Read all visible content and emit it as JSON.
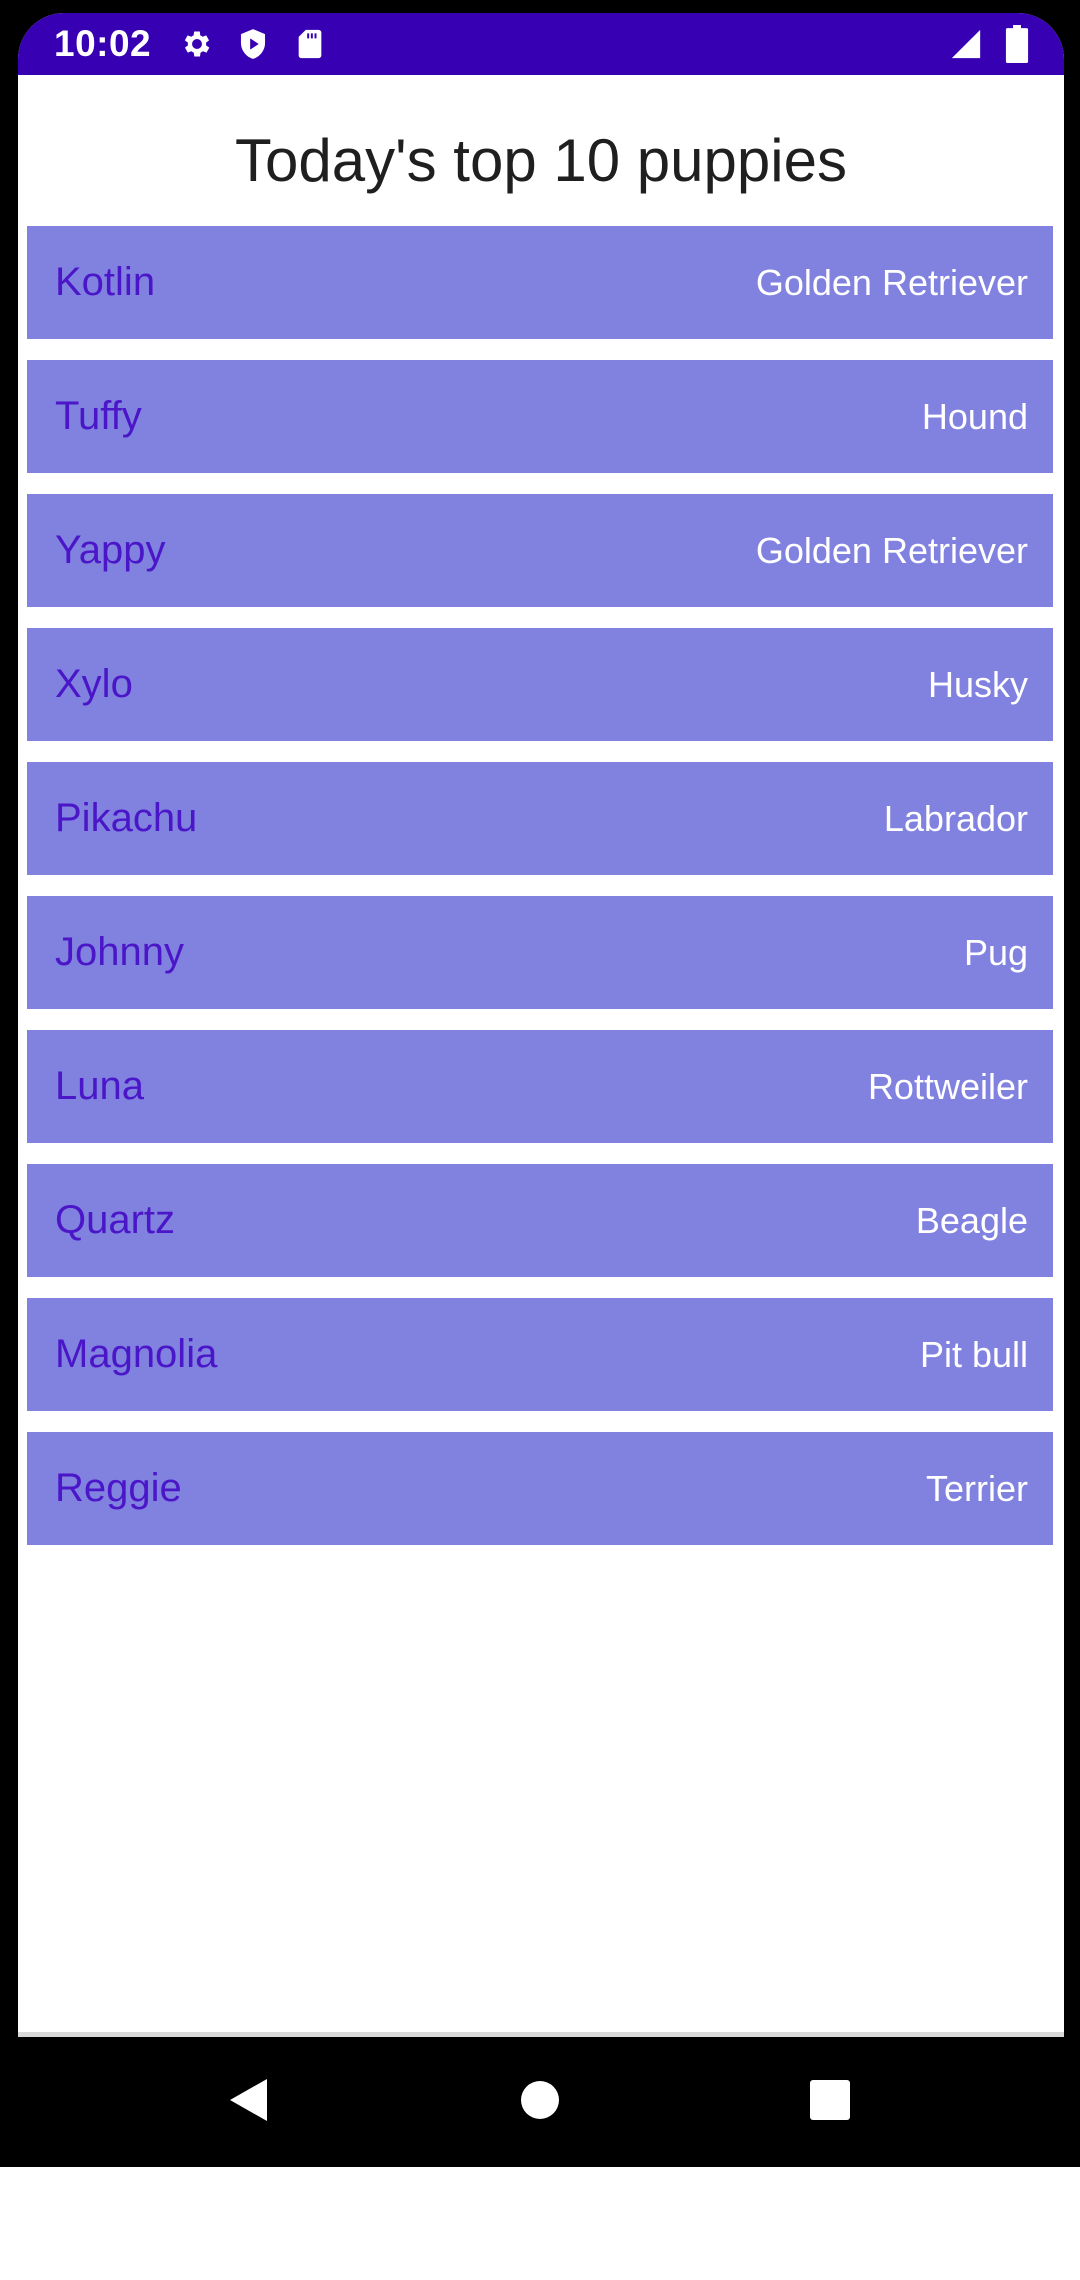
{
  "status_bar": {
    "time": "10:02",
    "background_color": "#3700b3",
    "icons": [
      "gear-icon",
      "shield-icon",
      "sd-card-icon",
      "signal-icon",
      "battery-icon"
    ]
  },
  "page": {
    "title": "Today's top 10 puppies"
  },
  "colors": {
    "row_background": "#8181df",
    "name_text": "#4a16c8",
    "breed_text": "#ffffff"
  },
  "puppies": [
    {
      "name": "Kotlin",
      "breed": "Golden Retriever"
    },
    {
      "name": "Tuffy",
      "breed": "Hound"
    },
    {
      "name": "Yappy",
      "breed": "Golden Retriever"
    },
    {
      "name": "Xylo",
      "breed": "Husky"
    },
    {
      "name": "Pikachu",
      "breed": "Labrador"
    },
    {
      "name": "Johnny",
      "breed": "Pug"
    },
    {
      "name": "Luna",
      "breed": "Rottweiler"
    },
    {
      "name": "Quartz",
      "breed": "Beagle"
    },
    {
      "name": "Magnolia",
      "breed": "Pit bull"
    },
    {
      "name": "Reggie",
      "breed": "Terrier"
    }
  ],
  "navigation_bar": {
    "buttons": [
      "back-icon",
      "home-icon",
      "recents-icon"
    ]
  }
}
